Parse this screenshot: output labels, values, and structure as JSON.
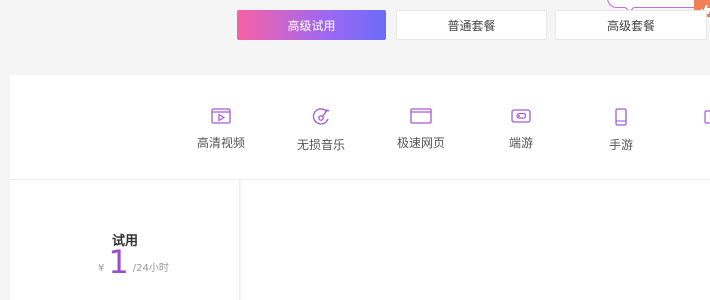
{
  "tabs": [
    {
      "label": "高级试用",
      "active": true
    },
    {
      "label": "普通套餐",
      "active": false
    },
    {
      "label": "高级套餐",
      "active": false
    }
  ],
  "features": [
    {
      "label": "高清视频",
      "icon": "video-icon"
    },
    {
      "label": "无损音乐",
      "icon": "music-disc-icon"
    },
    {
      "label": "极速网页",
      "icon": "browser-window-icon"
    },
    {
      "label": "端游",
      "icon": "gamepad-icon"
    },
    {
      "label": "手游",
      "icon": "phone-icon"
    }
  ],
  "plan": {
    "name": "试用",
    "currency": "¥",
    "amount": "1",
    "period": "/24小时"
  },
  "colors": {
    "accent_start": "#f862a3",
    "accent_end": "#6c6cf9",
    "icon": "#a35ad8",
    "price": "#9b4fd0",
    "badge": "#f37f54"
  }
}
